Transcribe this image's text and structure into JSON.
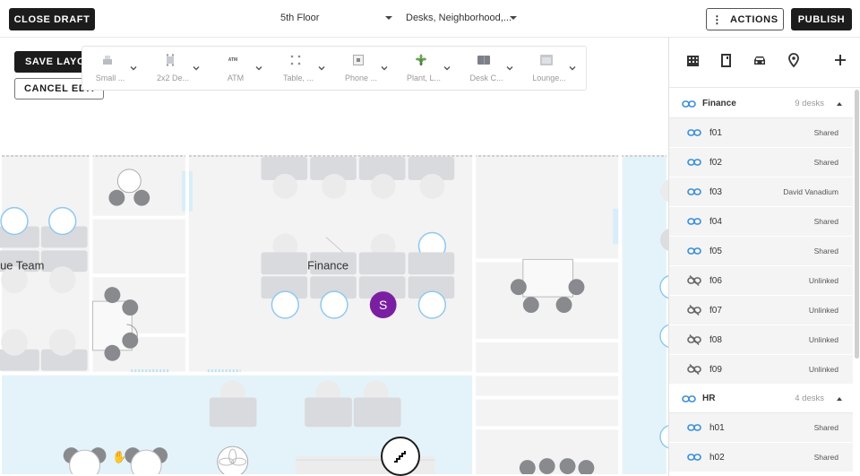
{
  "topbar": {
    "close_draft": "CLOSE DRAFT",
    "floor_select": "5th Floor",
    "layer_select": "Desks, Neighborhood,...",
    "actions": "ACTIONS",
    "publish": "PUBLISH"
  },
  "editor": {
    "save_layout": "SAVE LAYOUT",
    "cancel_edit": "CANCEL EDIT"
  },
  "palette": {
    "items": [
      {
        "label": "Small ...",
        "icon": "small-table-icon"
      },
      {
        "label": "2x2 De...",
        "icon": "desk-cluster-icon"
      },
      {
        "label": "ATM",
        "icon": "atm-icon",
        "icon_text": "ATM"
      },
      {
        "label": "Table, ...",
        "icon": "table-icon"
      },
      {
        "label": "Phone ...",
        "icon": "phone-booth-icon"
      },
      {
        "label": "Plant, L...",
        "icon": "plant-icon"
      },
      {
        "label": "Desk C...",
        "icon": "desk-chair-icon"
      },
      {
        "label": "Lounge...",
        "icon": "lounge-icon"
      }
    ]
  },
  "floorplan": {
    "labels": {
      "team_left": "ue Team",
      "finance": "Finance",
      "occupant_initial": "S"
    },
    "colors": {
      "occupant": "#7b1fa2",
      "desk_ring": "#8ec9ee",
      "water": "#e6f4fb"
    }
  },
  "sidebar": {
    "icons": [
      "building-icon",
      "room-icon",
      "car-icon",
      "location-pin-icon",
      "plus-icon"
    ],
    "groups": [
      {
        "name": "Finance",
        "count": "9 desks",
        "rows": [
          {
            "name": "f01",
            "status": "Shared",
            "linked": true
          },
          {
            "name": "f02",
            "status": "Shared",
            "linked": true
          },
          {
            "name": "f03",
            "status": "David Vanadium",
            "linked": true
          },
          {
            "name": "f04",
            "status": "Shared",
            "linked": true
          },
          {
            "name": "f05",
            "status": "Shared",
            "linked": true
          },
          {
            "name": "f06",
            "status": "Unlinked",
            "linked": false
          },
          {
            "name": "f07",
            "status": "Unlinked",
            "linked": false
          },
          {
            "name": "f08",
            "status": "Unlinked",
            "linked": false
          },
          {
            "name": "f09",
            "status": "Unlinked",
            "linked": false
          }
        ]
      },
      {
        "name": "HR",
        "count": "4 desks",
        "rows": [
          {
            "name": "h01",
            "status": "Shared",
            "linked": true
          },
          {
            "name": "h02",
            "status": "Shared",
            "linked": true
          }
        ]
      }
    ]
  },
  "colors": {
    "link_blue": "#3b8fd6",
    "unlinked_gray": "#777777",
    "dark_button": "#1c1c1c"
  }
}
